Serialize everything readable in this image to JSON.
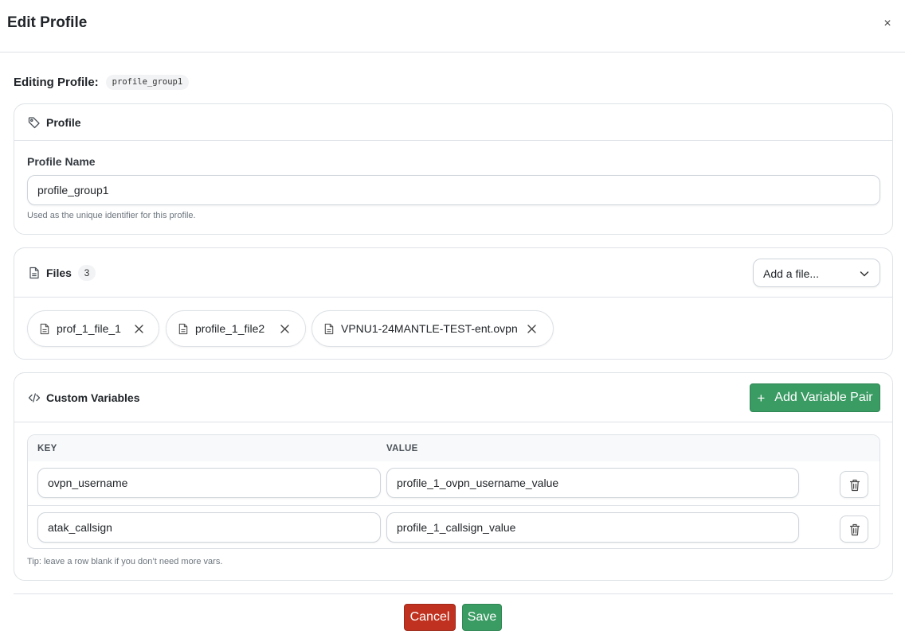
{
  "modal": {
    "title": "Edit Profile",
    "close_label": "×"
  },
  "editing": {
    "label": "Editing Profile:",
    "profile_id": "profile_group1"
  },
  "profile_card": {
    "title": "Profile",
    "icon": "tag-icon",
    "field_label": "Profile Name",
    "field_value": "profile_group1",
    "help_text": "Used as the unique identifier for this profile."
  },
  "files_card": {
    "title": "Files",
    "icon": "file-icon",
    "count": "3",
    "add_placeholder": "Add a file...",
    "files": [
      {
        "name": "prof_1_file_1"
      },
      {
        "name": "profile_1_file2"
      },
      {
        "name": "VPNU1-24MANTLE-TEST-ent.ovpn"
      }
    ]
  },
  "vars_card": {
    "title": "Custom Variables",
    "icon": "code-icon",
    "add_button": "Add Variable Pair",
    "columns": {
      "key": "KEY",
      "value": "VALUE"
    },
    "rows": [
      {
        "key": "ovpn_username",
        "value": "profile_1_ovpn_username_value"
      },
      {
        "key": "atak_callsign",
        "value": "profile_1_callsign_value"
      }
    ],
    "tip": "Tip: leave a row blank if you don’t need more vars."
  },
  "footer": {
    "cancel_label": "Cancel",
    "save_label": "Save"
  },
  "colors": {
    "primary_green": "#3a9b63",
    "danger_red": "#c0321f",
    "border": "#dee2e6"
  }
}
